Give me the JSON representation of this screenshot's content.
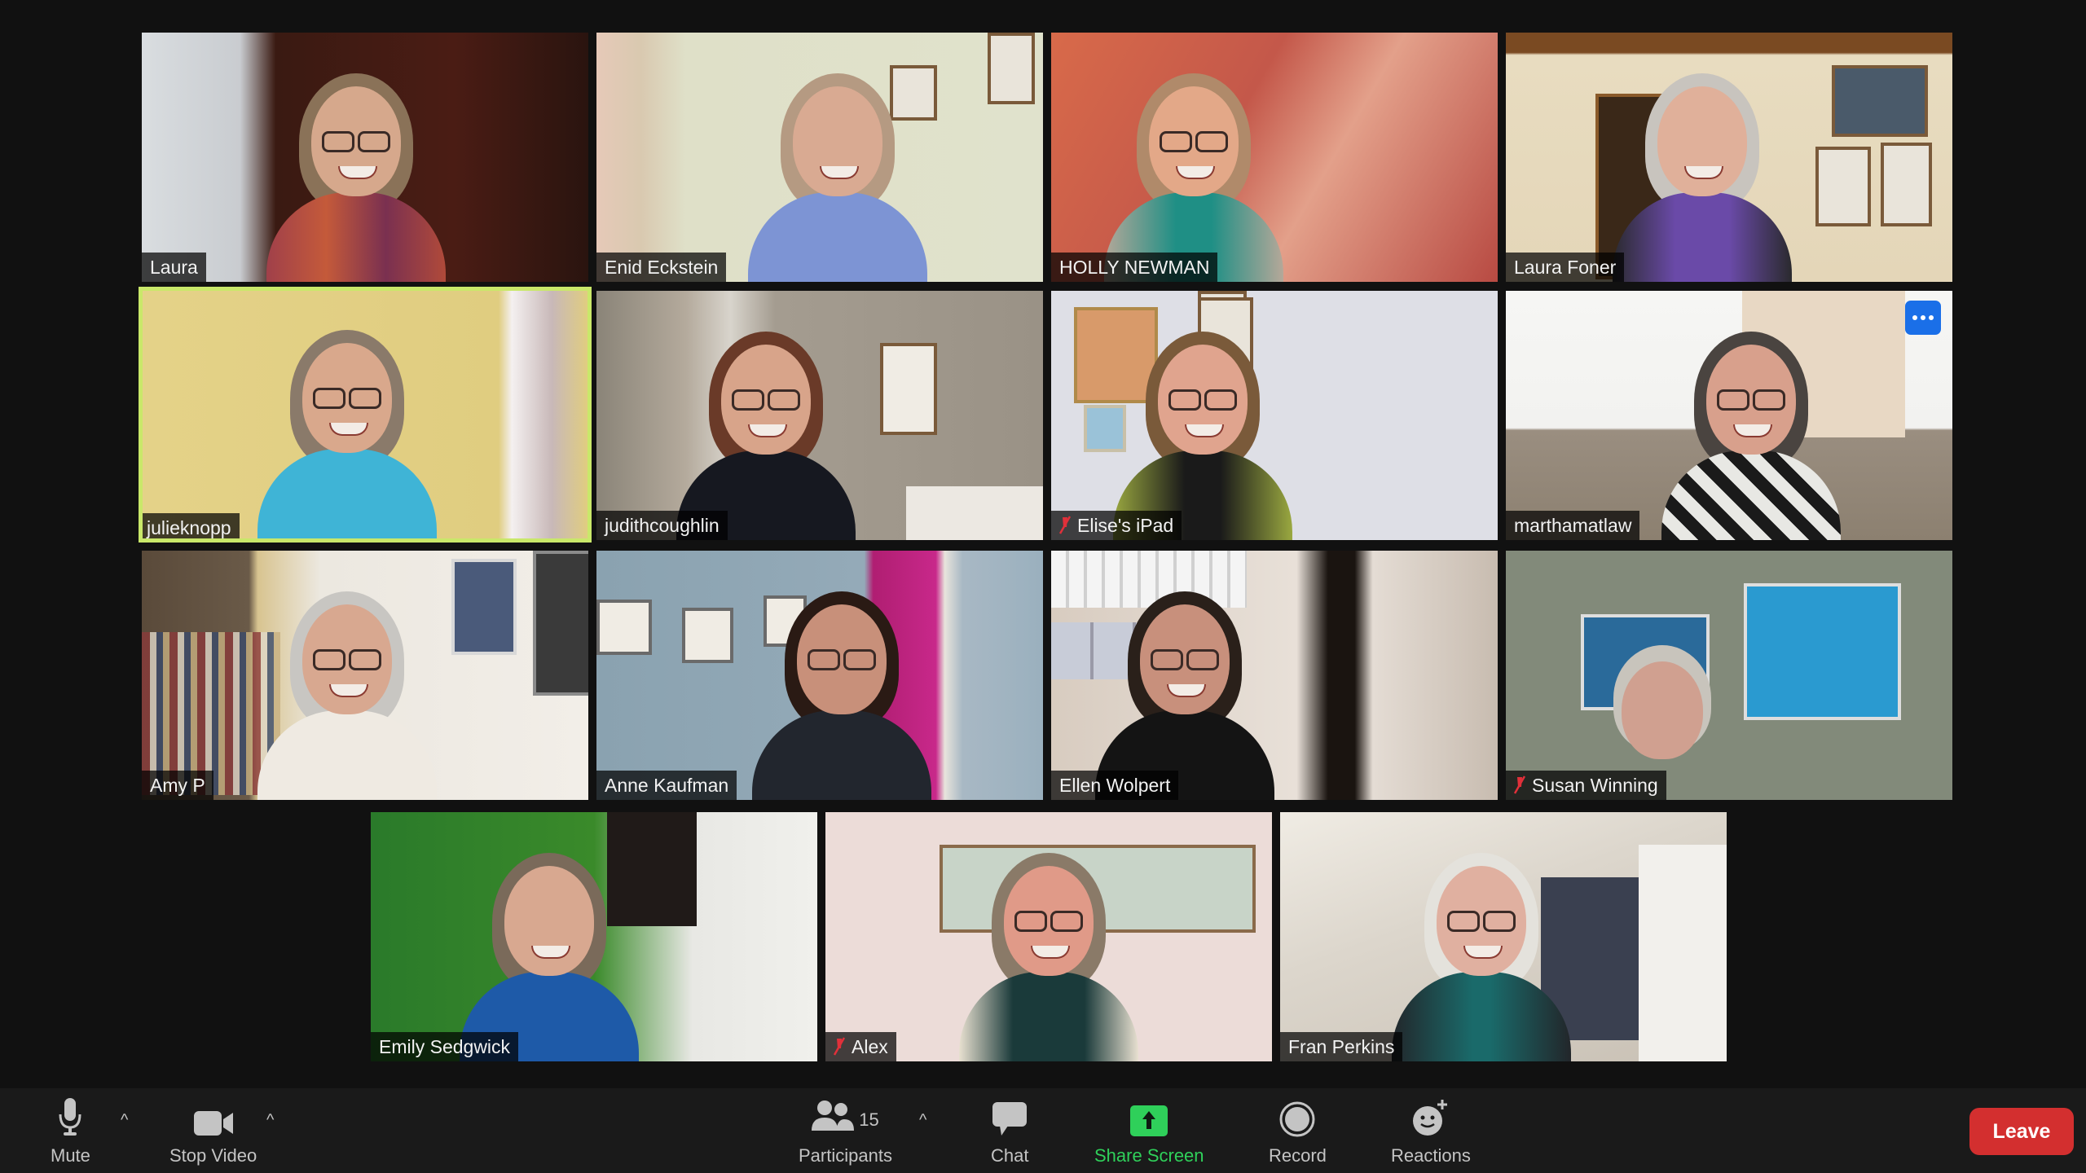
{
  "meeting": {
    "participant_count": "15",
    "participants": [
      {
        "name": "Laura",
        "muted": false,
        "active_speaker": false
      },
      {
        "name": "Enid Eckstein",
        "muted": false,
        "active_speaker": false
      },
      {
        "name": "HOLLY NEWMAN",
        "muted": false,
        "active_speaker": false
      },
      {
        "name": "Laura Foner",
        "muted": false,
        "active_speaker": false
      },
      {
        "name": "julieknopp",
        "muted": false,
        "active_speaker": true
      },
      {
        "name": "judithcoughlin",
        "muted": false,
        "active_speaker": false
      },
      {
        "name": "Elise's iPad",
        "muted": true,
        "active_speaker": false
      },
      {
        "name": "marthamatlaw",
        "muted": false,
        "active_speaker": false,
        "has_more_menu": true
      },
      {
        "name": "Amy P",
        "muted": false,
        "active_speaker": false
      },
      {
        "name": "Anne Kaufman",
        "muted": false,
        "active_speaker": false
      },
      {
        "name": "Ellen Wolpert",
        "muted": false,
        "active_speaker": false
      },
      {
        "name": "Susan Winning",
        "muted": true,
        "active_speaker": false
      },
      {
        "name": "Emily Sedgwick",
        "muted": false,
        "active_speaker": false
      },
      {
        "name": "Alex",
        "muted": true,
        "active_speaker": false
      },
      {
        "name": "Fran Perkins",
        "muted": false,
        "active_speaker": false
      }
    ]
  },
  "toolbar": {
    "mute_label": "Mute",
    "stop_video_label": "Stop Video",
    "participants_label": "Participants",
    "chat_label": "Chat",
    "share_screen_label": "Share Screen",
    "record_label": "Record",
    "reactions_label": "Reactions",
    "leave_label": "Leave",
    "caret": "^"
  },
  "icons": {
    "mic": "microphone-icon",
    "video": "video-camera-icon",
    "participants": "participants-icon",
    "chat": "chat-bubble-icon",
    "share": "share-screen-arrow-icon",
    "record": "record-circle-icon",
    "reactions": "smiley-plus-icon",
    "muted": "muted-mic-icon",
    "more": "more-dots-icon"
  },
  "colors": {
    "active_speaker_border": "#c9e86a",
    "share_green": "#2fd05a",
    "leave_red": "#d32f2f",
    "more_blue": "#1a6fe8",
    "muted_red": "#e0303a"
  }
}
